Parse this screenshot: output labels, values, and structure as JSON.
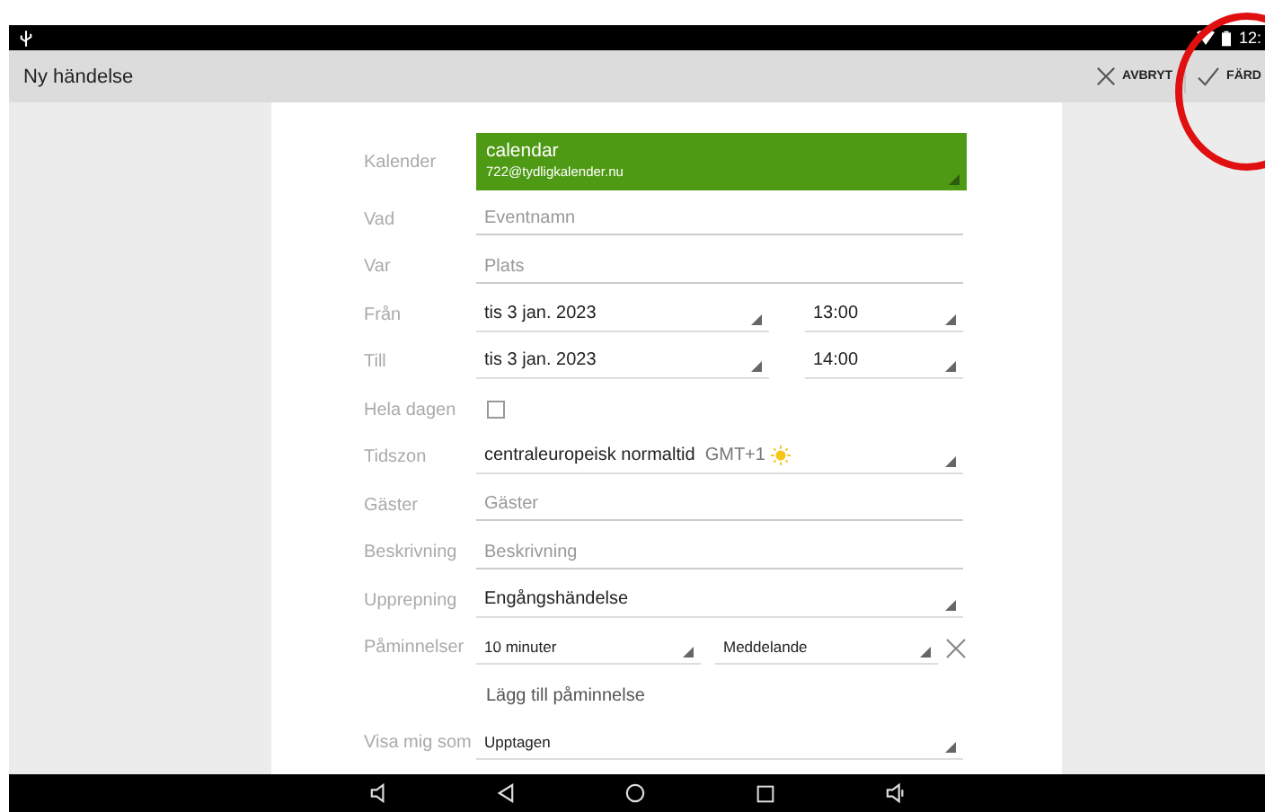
{
  "status_bar": {
    "time": "12:"
  },
  "toolbar": {
    "title": "Ny händelse",
    "actions": [
      {
        "label": "AVBRYT",
        "kind": "cancel"
      },
      {
        "label": "FÄRD",
        "kind": "done"
      }
    ]
  },
  "form": [
    {
      "kind": "calendar",
      "label": "Kalender",
      "value": "calendar",
      "account": "722@tydligkalender.nu"
    },
    {
      "kind": "text",
      "label": "Vad",
      "placeholder": "Eventnamn"
    },
    {
      "kind": "text",
      "label": "Var",
      "placeholder": "Plats"
    },
    {
      "kind": "datetime",
      "label": "Från",
      "date": "tis 3 jan. 2023",
      "time": "13:00"
    },
    {
      "kind": "datetime",
      "label": "Till",
      "date": "tis 3 jan. 2023",
      "time": "14:00"
    },
    {
      "kind": "checkbox",
      "label": "Hela dagen",
      "checked": false
    },
    {
      "kind": "timezone",
      "label": "Tidszon",
      "value": "centraleuropeisk normaltid",
      "offset": "GMT+1"
    },
    {
      "kind": "text",
      "label": "Gäster",
      "placeholder": "Gäster"
    },
    {
      "kind": "text",
      "label": "Beskrivning",
      "placeholder": "Beskrivning"
    },
    {
      "kind": "select",
      "label": "Upprepning",
      "value": "Engångshändelse"
    },
    {
      "kind": "reminder",
      "label": "Påminnelser",
      "time": "10 minuter",
      "method": "Meddelande"
    },
    {
      "kind": "link",
      "text": "Lägg till påminnelse"
    },
    {
      "kind": "select-small",
      "label": "Visa mig som",
      "value": "Upptagen"
    }
  ]
}
